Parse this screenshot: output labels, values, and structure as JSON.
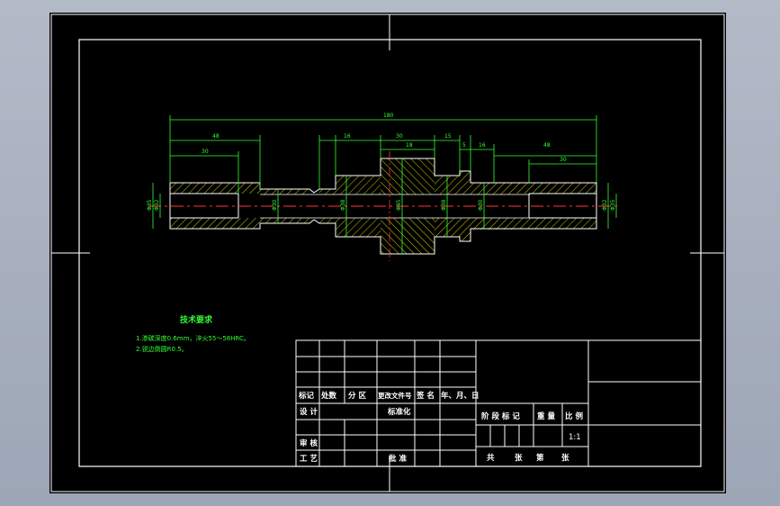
{
  "drawing": {
    "overall_dim": "180",
    "dims_left": [
      "48",
      "30"
    ],
    "dims_middle": [
      "16",
      "30",
      "18",
      "5",
      "15",
      "16"
    ],
    "dims_right": [
      "48",
      "30"
    ],
    "diameter_labels": [
      "Φ35",
      "Φ32",
      "Φ30",
      "Φ38",
      "Φ45",
      "Φ38",
      "Φ30",
      "Φ32",
      "Φ35"
    ]
  },
  "notes": {
    "title": "技术要求",
    "line1": "1.渗碳深度0.6mm，淬火55～58HRC。",
    "line2": "2.锐边倒圆R0.5。"
  },
  "title_block": {
    "rev_headers": [
      "标记",
      "处数",
      "分 区",
      "更改文件号",
      "签 名",
      "年、月、日"
    ],
    "design": "设 计",
    "standardize": "标准化",
    "review": "审 核",
    "process": "工 艺",
    "approve": "批 准",
    "stage_header": [
      "阶 段 标 记",
      "重 量",
      "比 例"
    ],
    "scale": "1:1",
    "sheets": [
      "共",
      "张",
      "第",
      "张"
    ]
  },
  "colors": {
    "background": "#000000",
    "frame": "#ffffff",
    "dimension": "#33ff33",
    "hatch": "#ffff00",
    "center_line": "#ff3333",
    "outline": "#ffffff"
  }
}
